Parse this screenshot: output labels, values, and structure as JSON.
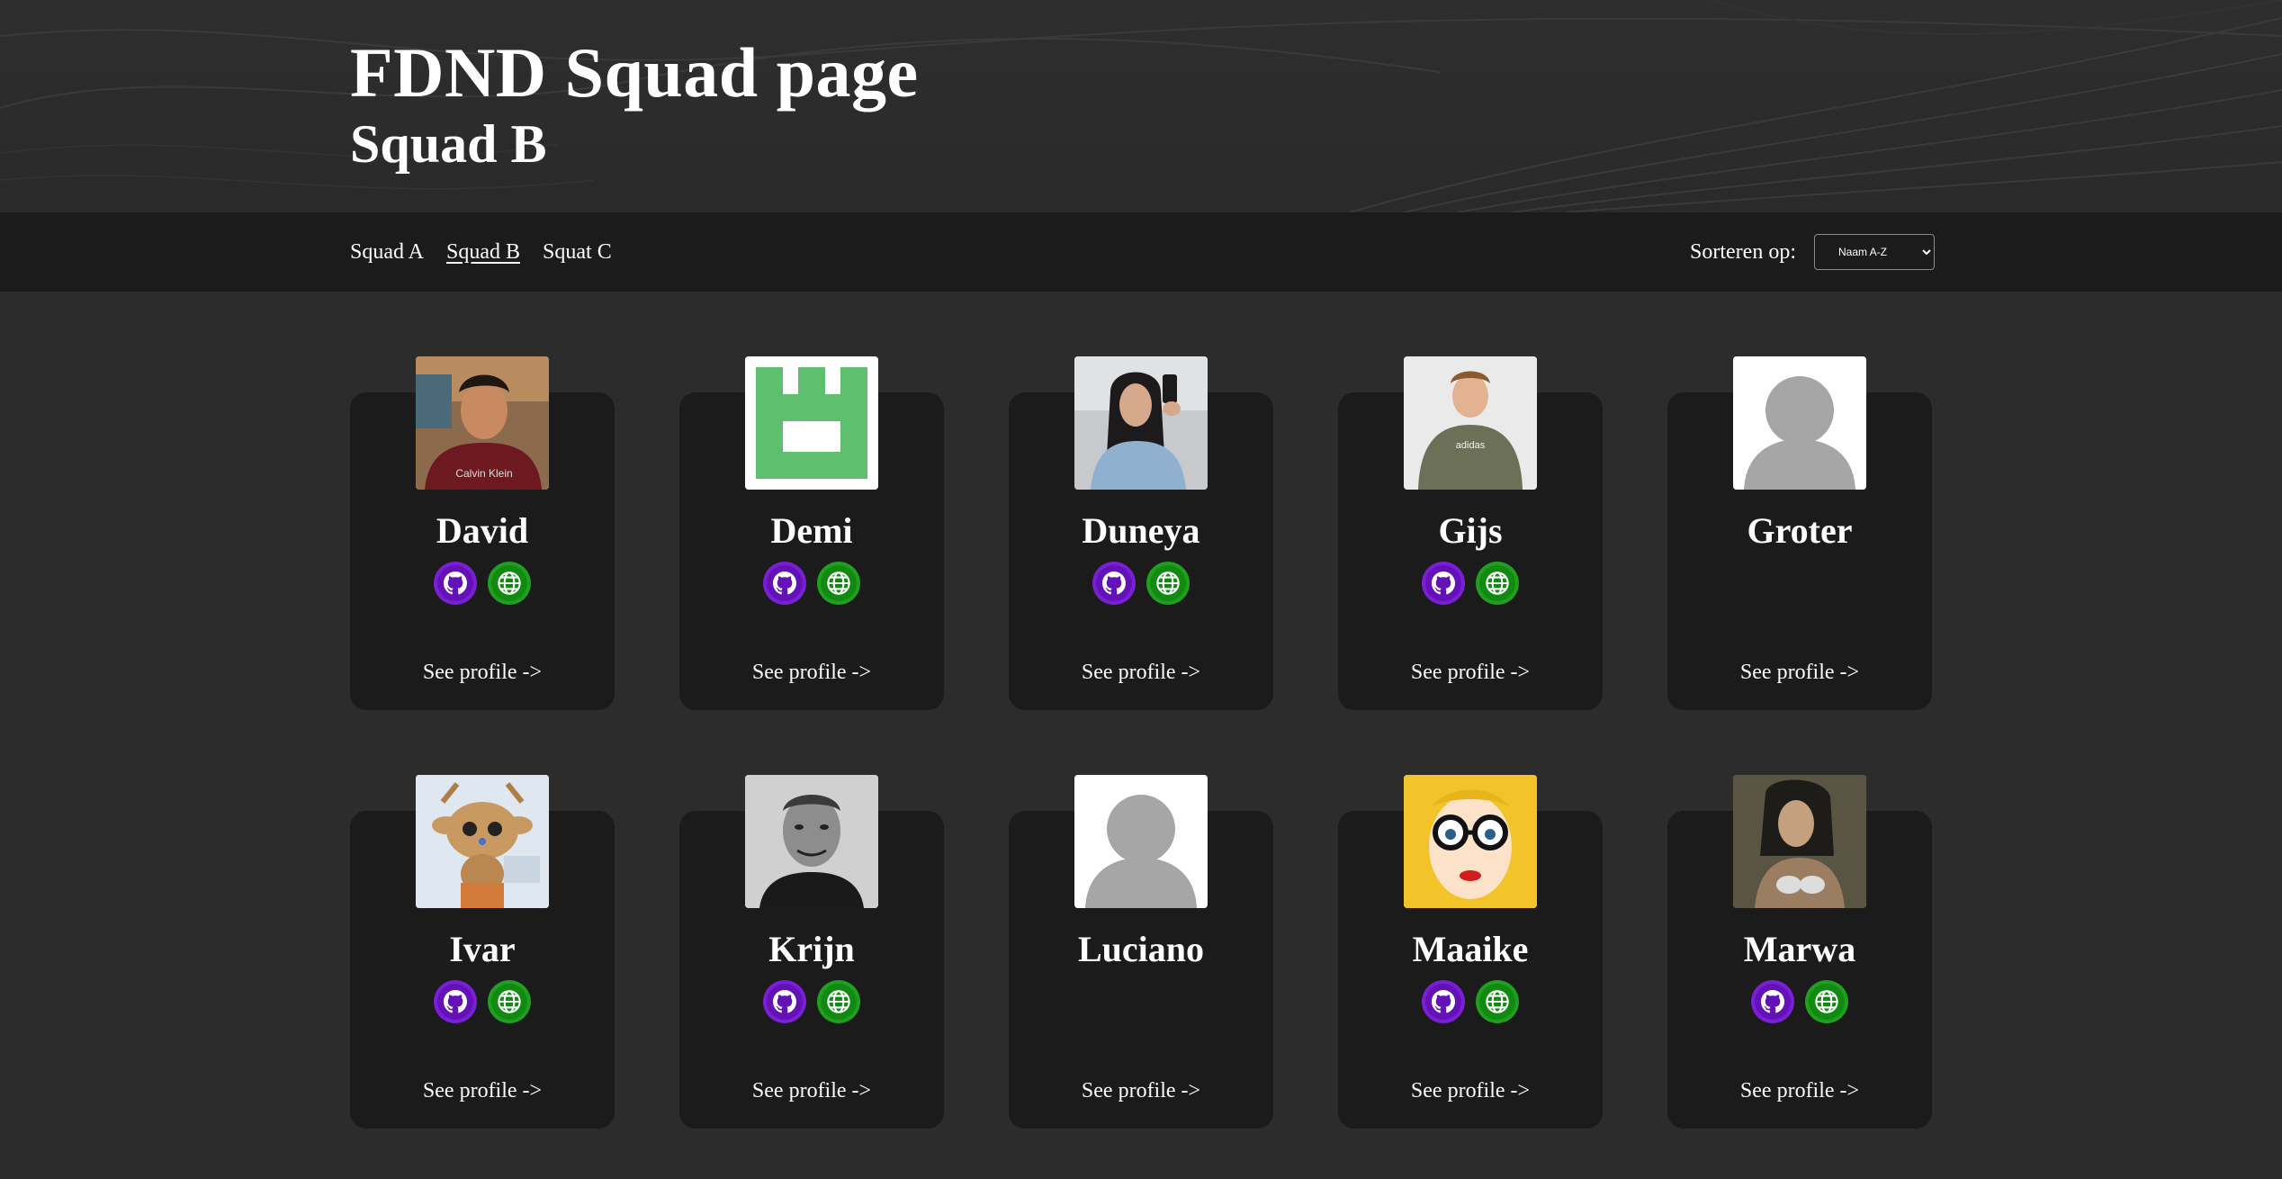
{
  "header": {
    "title": "FDND Squad page",
    "subtitle": "Squad B"
  },
  "nav": {
    "squads": [
      "Squad A",
      "Squad B",
      "Squat C"
    ],
    "active_index": 1,
    "sort_label": "Sorteren op:",
    "sort_value": "Naam A-Z"
  },
  "members": [
    {
      "name": "David",
      "avatar": "photo-person-red-shirt",
      "links": true,
      "profile_label": "See profile ->"
    },
    {
      "name": "Demi",
      "avatar": "green-pixel-logo",
      "links": true,
      "profile_label": "See profile ->"
    },
    {
      "name": "Duneya",
      "avatar": "photo-person-mirror-selfie",
      "links": true,
      "profile_label": "See profile ->"
    },
    {
      "name": "Gijs",
      "avatar": "photo-person-olive-shirt",
      "links": true,
      "profile_label": "See profile ->"
    },
    {
      "name": "Groter",
      "avatar": "placeholder-avatar",
      "links": false,
      "profile_label": "See profile ->"
    },
    {
      "name": "Ivar",
      "avatar": "cartoon-reindeer",
      "links": true,
      "profile_label": "See profile ->"
    },
    {
      "name": "Krijn",
      "avatar": "photo-person-grayscale",
      "links": true,
      "profile_label": "See profile ->"
    },
    {
      "name": "Luciano",
      "avatar": "placeholder-avatar",
      "links": false,
      "profile_label": "See profile ->"
    },
    {
      "name": "Maaike",
      "avatar": "cartoon-blonde-glasses",
      "links": true,
      "profile_label": "See profile ->"
    },
    {
      "name": "Marwa",
      "avatar": "anime-character-dark",
      "links": true,
      "profile_label": "See profile ->"
    }
  ],
  "colors": {
    "page_bg": "#2c2c2c",
    "panel_bg": "#1b1b1b",
    "github_icon_bg": "#7a1fd6",
    "website_icon_bg": "#1f9e1f"
  },
  "icons": {
    "github": "github-icon",
    "website": "globe-icon"
  }
}
